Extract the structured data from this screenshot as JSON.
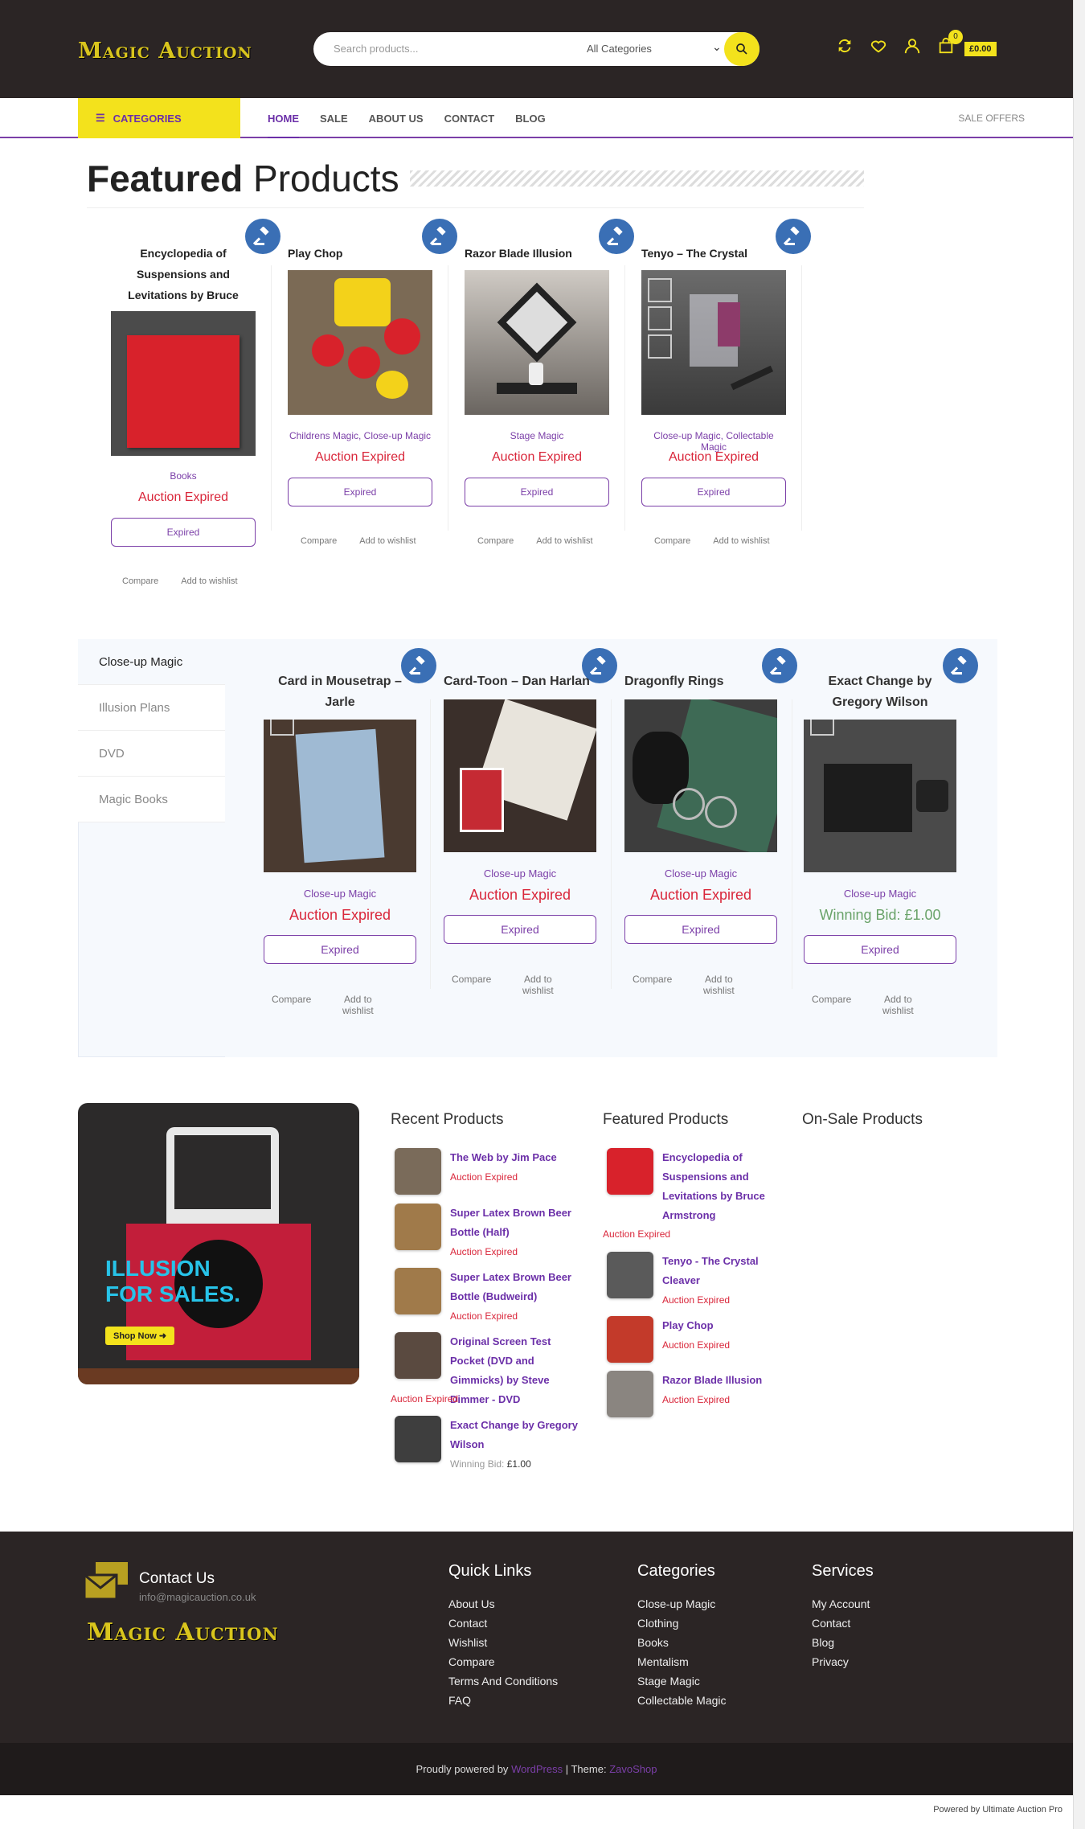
{
  "header": {
    "logo": "Magic Auction",
    "search_placeholder": "Search products...",
    "search_category": "All Categories",
    "cart_count": "0",
    "cart_total": "£0.00"
  },
  "nav": {
    "categories_label": "CATEGORIES",
    "links": [
      "HOME",
      "SALE",
      "ABOUT US",
      "CONTACT",
      "BLOG"
    ],
    "sale_offers": "SALE OFFERS"
  },
  "featured": {
    "title_bold": "Featured",
    "title_rest": " Products",
    "products": [
      {
        "name": "Encyclopedia of Suspensions and Levitations by Bruce Armstrong",
        "cats": [
          "Books"
        ],
        "status": "Auction Expired",
        "button": "Expired"
      },
      {
        "name": "Play Chop",
        "cats": [
          "Childrens Magic",
          "Close-up Magic"
        ],
        "status": "Auction Expired",
        "button": "Expired"
      },
      {
        "name": "Razor Blade Illusion",
        "cats": [
          "Stage Magic"
        ],
        "status": "Auction Expired",
        "button": "Expired"
      },
      {
        "name": "Tenyo – The Crystal Cleaver",
        "cats": [
          "Close-up Magic",
          "Collectable Magic"
        ],
        "status": "Auction Expired",
        "button": "Expired"
      }
    ],
    "compare": "Compare",
    "wishlist": "Add to wishlist"
  },
  "tabs": {
    "items": [
      "Close-up Magic",
      "Illusion Plans",
      "DVD",
      "Magic Books"
    ],
    "products": [
      {
        "name": "Card in Mousetrap – Jarle",
        "cat": "Close-up Magic",
        "status": "Auction Expired",
        "button": "Expired"
      },
      {
        "name": "Card-Toon – Dan Harlan",
        "cat": "Close-up Magic",
        "status": "Auction Expired",
        "button": "Expired"
      },
      {
        "name": "Dragonfly Rings",
        "cat": "Close-up Magic",
        "status": "Auction Expired",
        "button": "Expired"
      },
      {
        "name": "Exact Change by Gregory Wilson",
        "cat": "Close-up Magic",
        "status": "Winning Bid: £1.00",
        "button": "Expired"
      }
    ],
    "compare": "Compare",
    "wishlist": "Add to wishlist"
  },
  "banner": {
    "line1": "ILLUSION",
    "line2": "FOR SALES.",
    "button": "Shop Now"
  },
  "widgets": {
    "recent_title": "Recent Products",
    "recent": [
      {
        "name": "The Web by Jim Pace",
        "status": "Auction Expired"
      },
      {
        "name": "Super Latex Brown Beer Bottle (Half)",
        "status": "Auction Expired"
      },
      {
        "name": "Super Latex Brown Beer Bottle (Budweird)",
        "status": "Auction Expired"
      },
      {
        "name": "Original Screen Test Pocket (DVD and Gimmicks) by Steve Dimmer - DVD",
        "status": "Auction Expired"
      },
      {
        "name": "Exact Change by Gregory Wilson",
        "status_label": "Winning Bid:",
        "status_value": "£1.00"
      }
    ],
    "featured_title": "Featured Products",
    "featured": [
      {
        "name": "Encyclopedia of Suspensions and Levitations by Bruce Armstrong",
        "status": "Auction Expired"
      },
      {
        "name": "Tenyo - The Crystal Cleaver",
        "status": "Auction Expired"
      },
      {
        "name": "Play Chop",
        "status": "Auction Expired"
      },
      {
        "name": "Razor Blade Illusion",
        "status": "Auction Expired"
      }
    ],
    "sale_title": "On-Sale Products"
  },
  "footer": {
    "contact_title": "Contact Us",
    "contact_email": "info@magicauction.co.uk",
    "logo": "Magic Auction",
    "quick_title": "Quick Links",
    "quick": [
      "About Us",
      "Contact",
      "Wishlist",
      "Compare",
      "Terms And Conditions",
      "FAQ"
    ],
    "cat_title": "Categories",
    "cats": [
      "Close-up Magic",
      "Clothing",
      "Books",
      "Mentalism",
      "Stage Magic",
      "Collectable Magic"
    ],
    "services_title": "Services",
    "services": [
      "My Account",
      "Contact",
      "Blog",
      "Privacy"
    ],
    "copy_prefix": "Proudly powered by",
    "copy_wp": "WordPress",
    "copy_mid": " | Theme: ",
    "copy_theme": "ZavoShop",
    "powered": "Powered by Ultimate Auction Pro"
  },
  "colors": {
    "accent": "#7b3fa8",
    "yellow": "#f3e21c",
    "dark": "#2b2525",
    "expired": "#d9263a",
    "badge": "#3a6fb5"
  }
}
